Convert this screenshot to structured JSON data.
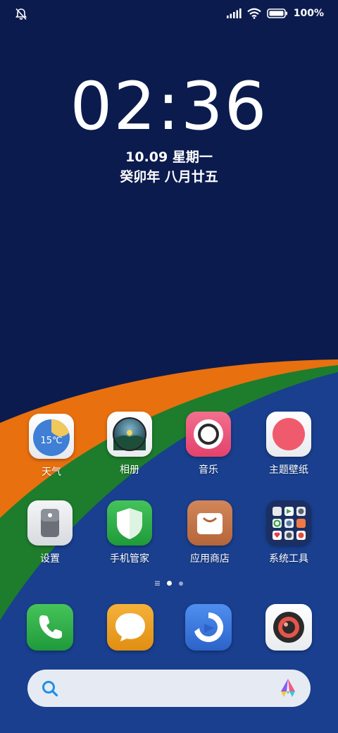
{
  "status_bar": {
    "icons": [
      "bell-off-icon",
      "signal-icon",
      "wifi-icon",
      "battery-icon"
    ],
    "battery_text": "100%"
  },
  "lockscreen": {
    "time": "02:36",
    "date": "10.09 星期一",
    "lunar_date": "癸卯年 八月廿五"
  },
  "apps": {
    "weather": {
      "label": "天气",
      "temp": "15℃"
    },
    "gallery": {
      "label": "相册"
    },
    "music": {
      "label": "音乐"
    },
    "themes": {
      "label": "主题壁纸"
    },
    "settings": {
      "label": "设置"
    },
    "security": {
      "label": "手机管家"
    },
    "appstore": {
      "label": "应用商店"
    },
    "tools": {
      "label": "系统工具"
    }
  },
  "page_indicator": {
    "current": 1,
    "total": 2
  },
  "dock": {
    "icons": [
      "phone-icon",
      "messages-icon",
      "browser-icon",
      "camera-icon"
    ]
  },
  "search": {
    "icons": [
      "search-icon",
      "assistant-icon"
    ]
  },
  "colors": {
    "wallpaper_navy": "#0b1b4e",
    "wave_orange": "#e8700f",
    "wave_green": "#1d7d2c",
    "wallpaper_blue": "#193f8e"
  }
}
